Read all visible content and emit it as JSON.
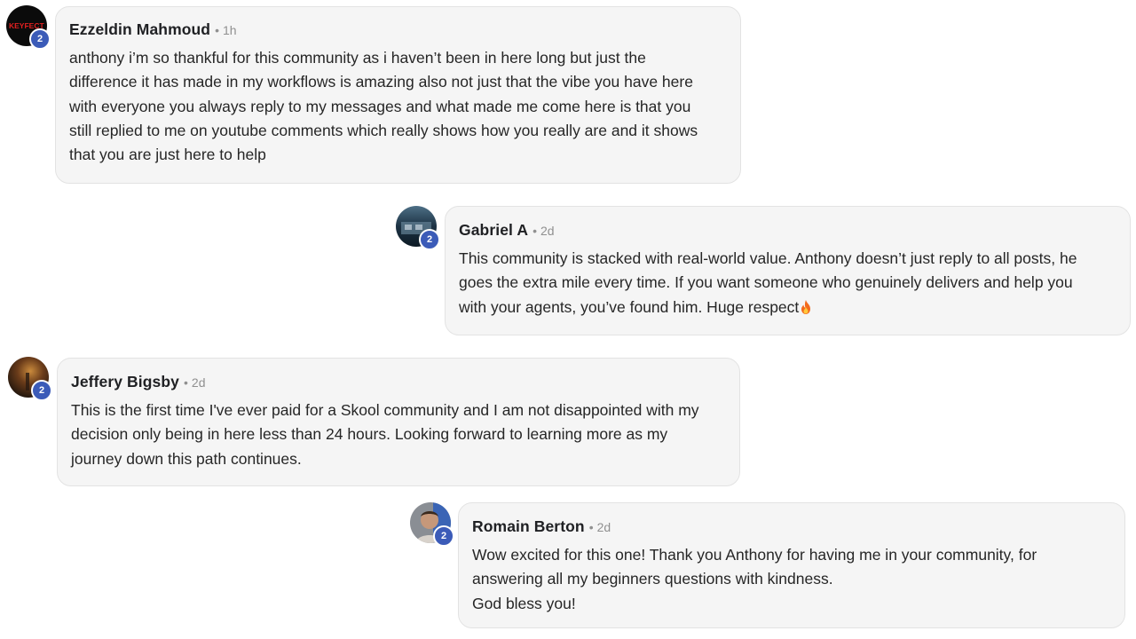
{
  "comments": [
    {
      "author": "Ezzeldin Mahmoud",
      "time": "1h",
      "level": "2",
      "avatar_text": "KEYFECT",
      "text": "anthony i’m so thankful for this community as i haven’t been in here long but just the\ndifference it has made in my workflows is amazing also not just that the vibe you have here\nwith everyone you always reply to my messages and what made me come here is that you\nstill replied to me on youtube comments which really shows how you really are and it shows\nthat you are just here to help"
    },
    {
      "author": "Gabriel A",
      "time": "2d",
      "level": "2",
      "text": "This community is stacked with real-world value. Anthony doesn’t just reply to all posts, he\ngoes the extra mile every time. If you want someone who genuinely delivers and help you\nwith your agents, you’ve found him. Huge respect",
      "trailing_icon": "fire-emoji-icon"
    },
    {
      "author": "Jeffery Bigsby",
      "time": "2d",
      "level": "2",
      "text": "This is the first time I've ever paid for a Skool community and I am not disappointed with my\ndecision only being in here less than 24 hours. Looking forward to learning more as my\njourney down this path continues."
    },
    {
      "author": "Romain Berton",
      "time": "2d",
      "level": "2",
      "text": "Wow excited for this one! Thank you Anthony for having me in your community, for\nanswering all my beginners questions with kindness.\nGod bless you!"
    }
  ],
  "separator": "•",
  "colors": {
    "bubble_bg": "#f5f5f5",
    "bubble_border": "#e3e3e3",
    "level_badge": "#3b5bb8",
    "meta_text": "#909090"
  }
}
